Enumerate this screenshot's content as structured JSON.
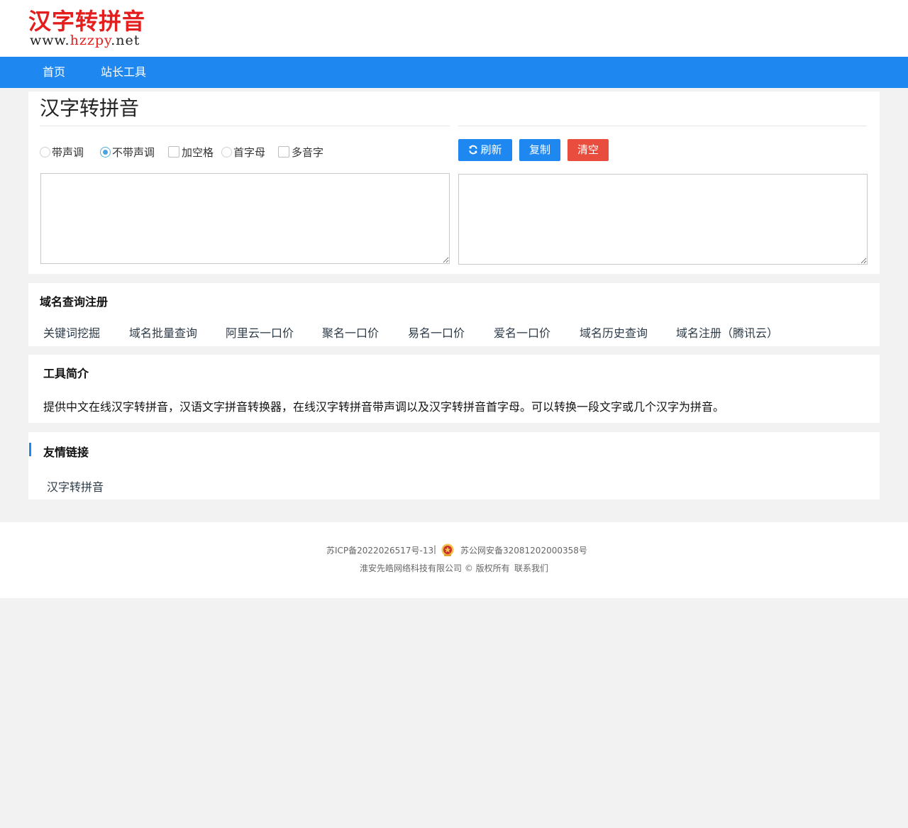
{
  "logo": {
    "main": "汉字转拼音",
    "url_prefix": "www.",
    "url_name": "hzzpy",
    "url_suffix": ".net"
  },
  "nav": {
    "items": [
      "首页",
      "站长工具"
    ]
  },
  "converter": {
    "title": "汉字转拼音",
    "options": [
      {
        "type": "radio",
        "label": "带声调",
        "checked": false
      },
      {
        "type": "radio",
        "label": "不带声调",
        "checked": true
      },
      {
        "type": "checkbox",
        "label": "加空格",
        "checked": false
      },
      {
        "type": "radio",
        "label": "首字母",
        "checked": false
      },
      {
        "type": "checkbox",
        "label": "多音字",
        "checked": false
      }
    ],
    "buttons": {
      "refresh": "刷新",
      "copy": "复制",
      "clear": "清空"
    },
    "input_value": "",
    "output_value": ""
  },
  "domain_section": {
    "title": "域名查询注册",
    "links": [
      "关键词挖掘",
      "域名批量查询",
      "阿里云一口价",
      "聚名一口价",
      "易名一口价",
      "爱名一口价",
      "域名历史查询",
      "域名注册（腾讯云）"
    ]
  },
  "intro_section": {
    "title": "工具简介",
    "text": "提供中文在线汉字转拼音，汉语文字拼音转换器，在线汉字转拼音带声调以及汉字转拼音首字母。可以转换一段文字或几个汉字为拼音。"
  },
  "friends_section": {
    "title": "友情链接",
    "links": [
      "汉字转拼音"
    ]
  },
  "footer": {
    "icp": "苏ICP备2022026517号-13",
    "separator": "|",
    "police": "苏公网安备32081202000358号",
    "company": "淮安先皓网络科技有限公司 © 版权所有",
    "contact": "联系我们"
  },
  "colors": {
    "accent": "#1e88f0",
    "danger": "#e84d3d",
    "logo_red": "#e41d1d"
  }
}
